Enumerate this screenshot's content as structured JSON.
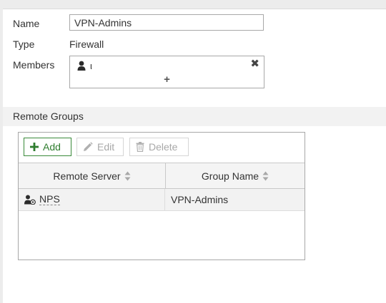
{
  "form": {
    "name_label": "Name",
    "name_value": "VPN-Admins",
    "type_label": "Type",
    "type_value": "Firewall",
    "members_label": "Members",
    "members": [
      {
        "name": "ι",
        "icon": "user-icon"
      }
    ],
    "add_member_symbol": "+",
    "remove_member_symbol": "✖"
  },
  "remote_groups": {
    "section_title": "Remote Groups",
    "toolbar": {
      "add_label": "Add",
      "edit_label": "Edit",
      "delete_label": "Delete"
    },
    "columns": [
      "Remote Server",
      "Group Name"
    ],
    "rows": [
      {
        "remote_server": "NPS",
        "group_name": "VPN-Admins",
        "server_icon": "radius-server-icon"
      }
    ]
  },
  "colors": {
    "accent_green": "#2e7d2e",
    "disabled_text": "#a8a8a8",
    "border": "#a8a8a8"
  }
}
